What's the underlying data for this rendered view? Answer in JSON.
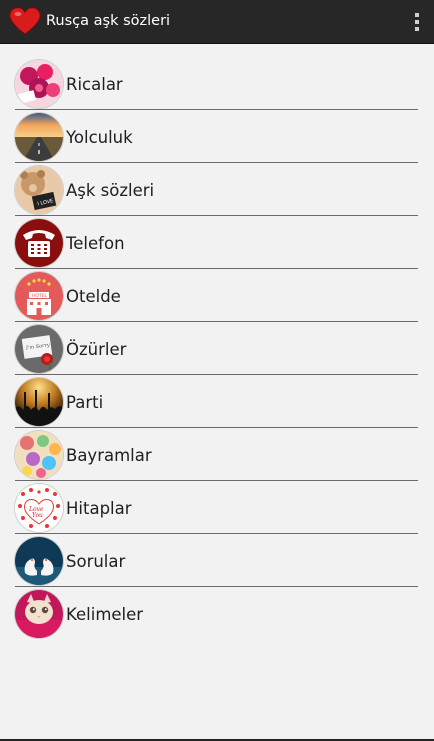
{
  "app": {
    "title": "Rusça aşk sözleri",
    "icon": "heart-icon",
    "menu_icon": "overflow-menu-icon"
  },
  "colors": {
    "actionbar": "#272727",
    "background": "#f2f2f2",
    "divider": "#6b6b6b",
    "heart": "#d81b1b"
  },
  "items": [
    {
      "label": "Ricalar",
      "icon": "roses-icon"
    },
    {
      "label": "Yolculuk",
      "icon": "road-icon"
    },
    {
      "label": "Aşk sözleri",
      "icon": "teddy-bear-icon"
    },
    {
      "label": "Telefon",
      "icon": "telephone-icon"
    },
    {
      "label": "Otelde",
      "icon": "hotel-icon"
    },
    {
      "label": "Özürler",
      "icon": "sorry-card-icon"
    },
    {
      "label": "Parti",
      "icon": "party-icon"
    },
    {
      "label": "Bayramlar",
      "icon": "holiday-icon"
    },
    {
      "label": "Hitaplar",
      "icon": "love-you-hearts-icon"
    },
    {
      "label": "Sorular",
      "icon": "swans-icon"
    },
    {
      "label": "Kelimeler",
      "icon": "kitten-icon"
    }
  ]
}
